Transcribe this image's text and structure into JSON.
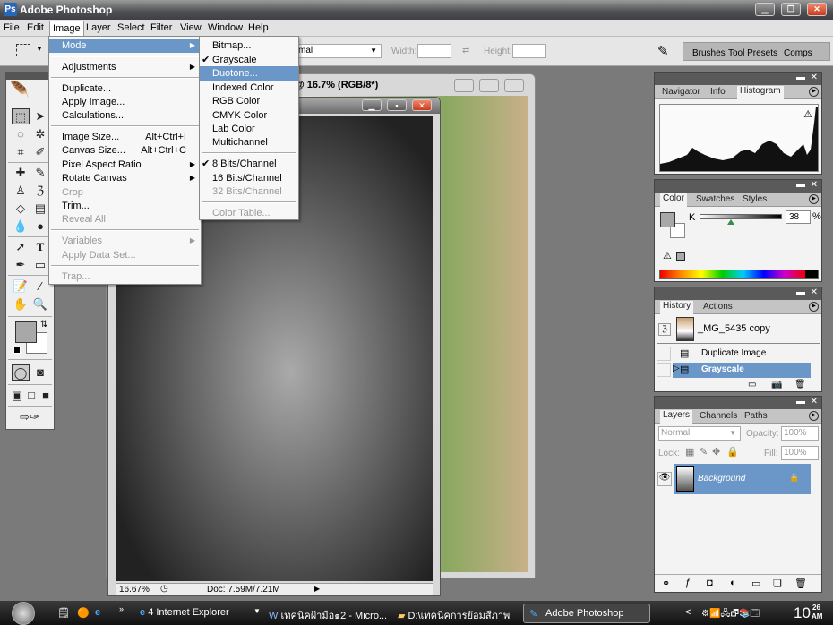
{
  "app": {
    "title": "Adobe Photoshop"
  },
  "menubar": [
    "File",
    "Edit",
    "Image",
    "Layer",
    "Select",
    "Filter",
    "View",
    "Window",
    "Help"
  ],
  "options": {
    "style_value": "mal",
    "width_label": "Width:",
    "height_label": "Height:"
  },
  "panel_well_tabs": [
    "Brushes",
    "Tool Presets",
    "Comps"
  ],
  "image_menu": {
    "items": [
      {
        "label": "Mode",
        "submenu": true,
        "highlight": true
      },
      {
        "label": "Adjustments",
        "submenu": true
      },
      {
        "label": "Duplicate..."
      },
      {
        "label": "Apply Image..."
      },
      {
        "label": "Calculations..."
      },
      {
        "label": "Image Size...",
        "shortcut": "Alt+Ctrl+I"
      },
      {
        "label": "Canvas Size...",
        "shortcut": "Alt+Ctrl+C"
      },
      {
        "label": "Pixel Aspect Ratio",
        "submenu": true
      },
      {
        "label": "Rotate Canvas",
        "submenu": true
      },
      {
        "label": "Crop",
        "disabled": true
      },
      {
        "label": "Trim..."
      },
      {
        "label": "Reveal All",
        "disabled": true
      },
      {
        "label": "Variables",
        "submenu": true,
        "disabled": true
      },
      {
        "label": "Apply Data Set...",
        "disabled": true
      },
      {
        "label": "Trap...",
        "disabled": true
      }
    ]
  },
  "mode_menu": {
    "items": [
      {
        "label": "Bitmap..."
      },
      {
        "label": "Grayscale",
        "checked": true
      },
      {
        "label": "Duotone...",
        "highlight": true
      },
      {
        "label": "Indexed Color"
      },
      {
        "label": "RGB Color"
      },
      {
        "label": "CMYK Color"
      },
      {
        "label": "Lab Color"
      },
      {
        "label": "Multichannel"
      },
      {
        "label": "8 Bits/Channel",
        "checked": true
      },
      {
        "label": "16 Bits/Channel"
      },
      {
        "label": "32 Bits/Channel",
        "disabled": true
      },
      {
        "label": "Color Table...",
        "disabled": true
      }
    ]
  },
  "document_back": {
    "title": "@ 16.7% (RGB/8*)"
  },
  "document_front": {
    "zoom": "16.67%",
    "doc_info": "Doc: 7.59M/7.21M"
  },
  "navigator_panel": {
    "tabs": [
      "Navigator",
      "Info",
      "Histogram"
    ],
    "active": "Histogram"
  },
  "color_panel": {
    "tabs": [
      "Color",
      "Swatches",
      "Styles"
    ],
    "active": "Color",
    "channel": "K",
    "value": "38",
    "unit": "%",
    "slider_fraction": 0.38
  },
  "history_panel": {
    "tabs": [
      "History",
      "Actions"
    ],
    "snapshot": "_MG_5435 copy",
    "states": [
      "Duplicate Image",
      "Grayscale"
    ],
    "active_state": "Grayscale"
  },
  "layers_panel": {
    "tabs": [
      "Layers",
      "Channels",
      "Paths"
    ],
    "blend_mode": "Normal",
    "opacity_label": "Opacity:",
    "opacity": "100%",
    "lock_label": "Lock:",
    "fill_label": "Fill:",
    "fill": "100%",
    "layers": [
      {
        "name": "Background",
        "locked": true,
        "selected": true
      }
    ]
  },
  "taskbar": {
    "items": [
      "4 Internet Explorer",
      "เทคนิคฝ้ามือ๑2 - Micro...",
      "D:\\เทคนิคการย้อมสีภาพ",
      "Adobe Photoshop"
    ],
    "clock_hour": "10",
    "clock_min": "26",
    "clock_ampm": "AM"
  }
}
